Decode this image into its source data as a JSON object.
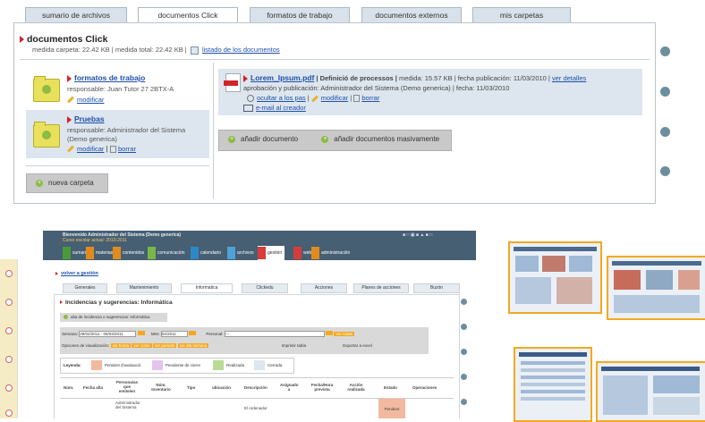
{
  "top_tabs": [
    "sumario de archivos",
    "documentos Click",
    "formatos de trabajo",
    "documentos externos",
    "mis carpetas"
  ],
  "page_title": "documentos Click",
  "folder_meta": {
    "size_text": "medida carpeta: 22.42 KB | medida total: 22.42 KB |",
    "list_link": "listado de los documentos"
  },
  "folders": [
    {
      "name": "formatos de trabajo",
      "responsible": "responsable: Juan Tutor 27 2BTX-A",
      "actions": [
        "modificar"
      ]
    },
    {
      "name": "Pruebas",
      "responsible": "responsable: Administrador del Sistema (Demo generica)",
      "actions": [
        "modificar",
        "borrar"
      ]
    }
  ],
  "new_folder_button": "nueva carpeta",
  "document": {
    "name": "Lorem_Ipsum.pdf",
    "description": "| Definició de processos |",
    "info": "medida: 15.57 KB | fecha publicación: 11/03/2010 |",
    "details_link": "ver detalles",
    "approval": "aprobación y publicación: Administrador del Sistema (Demo generica) | fecha: 11/03/2010",
    "actions": [
      "ocultar a los pas",
      "modificar",
      "borrar"
    ],
    "email_link": "e-mail al creador"
  },
  "document_buttons": [
    "añadir documento",
    "añadir documentos masivamente"
  ],
  "embedded_screenshot": {
    "header_title": "Bienvenido Administrador del Sistema (Demo generica)",
    "header_subtitle": "Curso escolar actual: 2010-2011",
    "nav": [
      {
        "letter": "S",
        "label": "sumario",
        "color": "#4a9a3c"
      },
      {
        "letter": "M",
        "label": "materias",
        "color": "#e38a1f"
      },
      {
        "letter": "C",
        "label": "contenidos",
        "color": "#e38a1f"
      },
      {
        "letter": "C",
        "label": "comunicación",
        "color": "#7ab648"
      },
      {
        "letter": "C",
        "label": "calendario",
        "color": "#2f87c4"
      },
      {
        "letter": "A",
        "label": "archivos",
        "color": "#4fa1d6"
      },
      {
        "letter": "G",
        "label": "gestión",
        "color": "#d73b3b"
      },
      {
        "letter": "W",
        "label": "web",
        "color": "#d73b3b"
      },
      {
        "letter": "A",
        "label": "administración",
        "color": "#e38a1f"
      }
    ],
    "back_link": "volver a gestión",
    "subtabs": [
      "Generales",
      "Mantenimiento",
      "Informática",
      "Clickedu",
      "Acciones",
      "Planes de acciones",
      "Buzón"
    ],
    "section_title": "Incidencias y sugerencias: Informática",
    "alta_button": "alta de incidencia o sugerencias: informática",
    "filters": {
      "semana_label": "Semana:",
      "semana_value": "28/02/2011 - 06/03/2011",
      "mes_label": "Mes:",
      "mes_value": "02/2011",
      "personal_label": "Personal:",
      "personal_value": "---",
      "all_btn": "Ver todas",
      "vis_label": "Opciones de visualización:",
      "vis_buttons": [
        "ver fecha",
        "ver coste",
        "ver periodo",
        "ver dia semana"
      ],
      "print_label": "Imprimir tabla",
      "export_label": "Exportar a excel"
    },
    "legend": {
      "label": "Leyenda:",
      "items": [
        {
          "text": "Pendent d'avaluació",
          "color": "#f3b8a0"
        },
        {
          "text": "Pendiente de cierre",
          "color": "#e4c4ec"
        },
        {
          "text": "Realizada",
          "color": "#b8dc95"
        },
        {
          "text": "Cerrada",
          "color": "#dde6ec"
        }
      ]
    },
    "table_headers": [
      "Núm.",
      "Fecha alta",
      "Persona/as que emite/en",
      "Núm. Inventario",
      "Tipo",
      "ubicación",
      "Descripción",
      "Asignado a",
      "Fecha/Hora prevista",
      "Acción realizada",
      "Estado",
      "Operaciones"
    ],
    "row_snippet": [
      "Administrador del Sistema",
      "El ordenador",
      "Pendent"
    ]
  }
}
